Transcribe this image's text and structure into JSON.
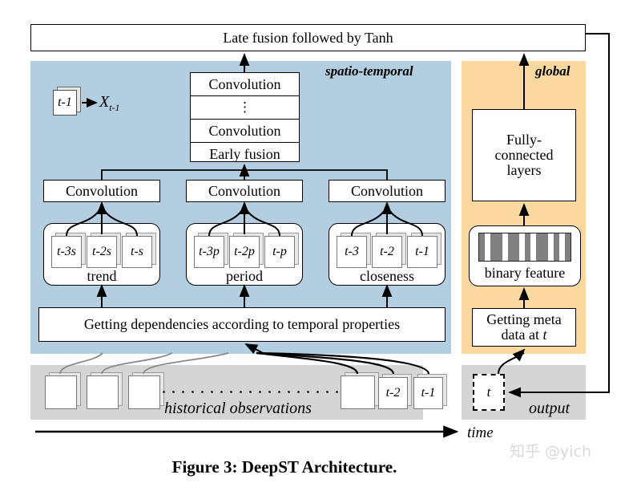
{
  "figure": {
    "caption": "Figure 3: DeepST Architecture.",
    "watermark": "知乎 @yich",
    "time_axis_label": "time"
  },
  "top": {
    "late_fusion_label": "Late fusion followed by Tanh"
  },
  "spatio_temporal": {
    "panel_label": "spatio-temporal",
    "legend": {
      "card_label": "t-1",
      "arrow": "right-arrow-icon",
      "variable": "X",
      "subscript": "t-1"
    },
    "conv_stack": {
      "rows": [
        "Convolution",
        "⋮",
        "Convolution",
        "Early fusion"
      ]
    },
    "branches": [
      {
        "conv_label": "Convolution",
        "group_name": "trend",
        "cards": [
          "t-3s",
          "t-2s",
          "t-s"
        ]
      },
      {
        "conv_label": "Convolution",
        "group_name": "period",
        "cards": [
          "t-3p",
          "t-2p",
          "t-p"
        ]
      },
      {
        "conv_label": "Convolution",
        "group_name": "closeness",
        "cards": [
          "t-3",
          "t-2",
          "t-1"
        ]
      }
    ],
    "dependency_box_label": "Getting dependencies according to temporal properties"
  },
  "global": {
    "panel_label": "global",
    "fully_connected_label": "Fully-\nconnected\nlayers",
    "fully_connected_lines": [
      "Fully-",
      "connected",
      "layers"
    ],
    "binary_feature_label": "binary feature",
    "binary_feature_bits": [
      1,
      0,
      1,
      1,
      0,
      1,
      1,
      0,
      1,
      0,
      1,
      1,
      0,
      1,
      0,
      1
    ],
    "meta_data_lines": [
      "Getting meta",
      "data at t"
    ]
  },
  "bottom": {
    "historical_label": "historical observations",
    "history_cards": [
      "",
      "",
      "",
      "",
      "t-2",
      "t-1"
    ],
    "output_card_label": "t",
    "output_label": "output"
  },
  "colors": {
    "spatio_temporal_panel": "#b3cee0",
    "global_panel": "#fbd8a0",
    "bottom_panel": "#d5d5d5",
    "stroke": "#000000",
    "faint_link": "#8a8a8a",
    "binary_on": "#808080",
    "binary_off": "#ffffff"
  }
}
